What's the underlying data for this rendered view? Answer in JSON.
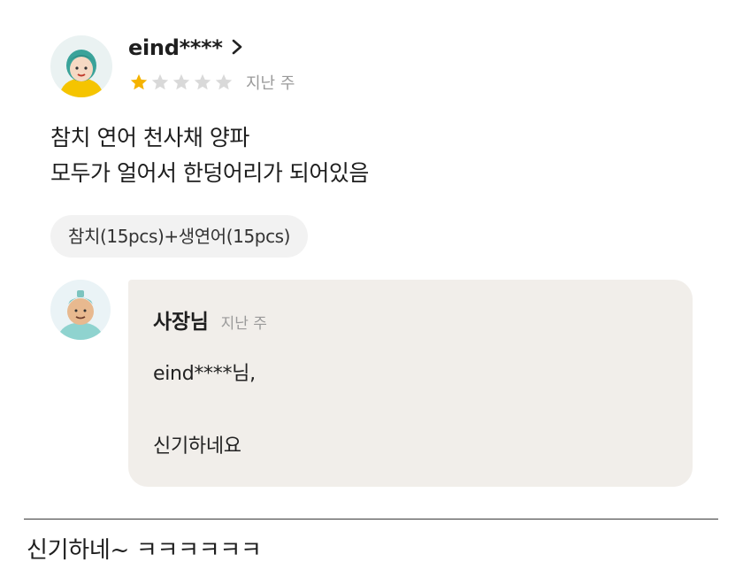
{
  "review": {
    "reviewer_name": "eind****",
    "rating": 1,
    "rating_max": 5,
    "date": "지난 주",
    "text_lines": [
      "참치 연어 천사채 양파",
      "모두가 얼어서 한덩어리가 되어있음"
    ],
    "option_chip": "참치(15pcs)+생연어(15pcs)"
  },
  "reply": {
    "owner_name": "사장님",
    "date": "지난 주",
    "line1": "eind****님,",
    "line2": "신기하네요"
  },
  "comment": {
    "text": "신기하네~ ㅋㅋㅋㅋㅋㅋ"
  },
  "colors": {
    "star_filled": "#f5b300",
    "star_empty": "#d9d9d9",
    "reply_bg": "#f1eeea",
    "chip_bg": "#f2f2f2"
  },
  "icons": {
    "chevron": "chevron-right-icon",
    "star": "star-icon"
  }
}
